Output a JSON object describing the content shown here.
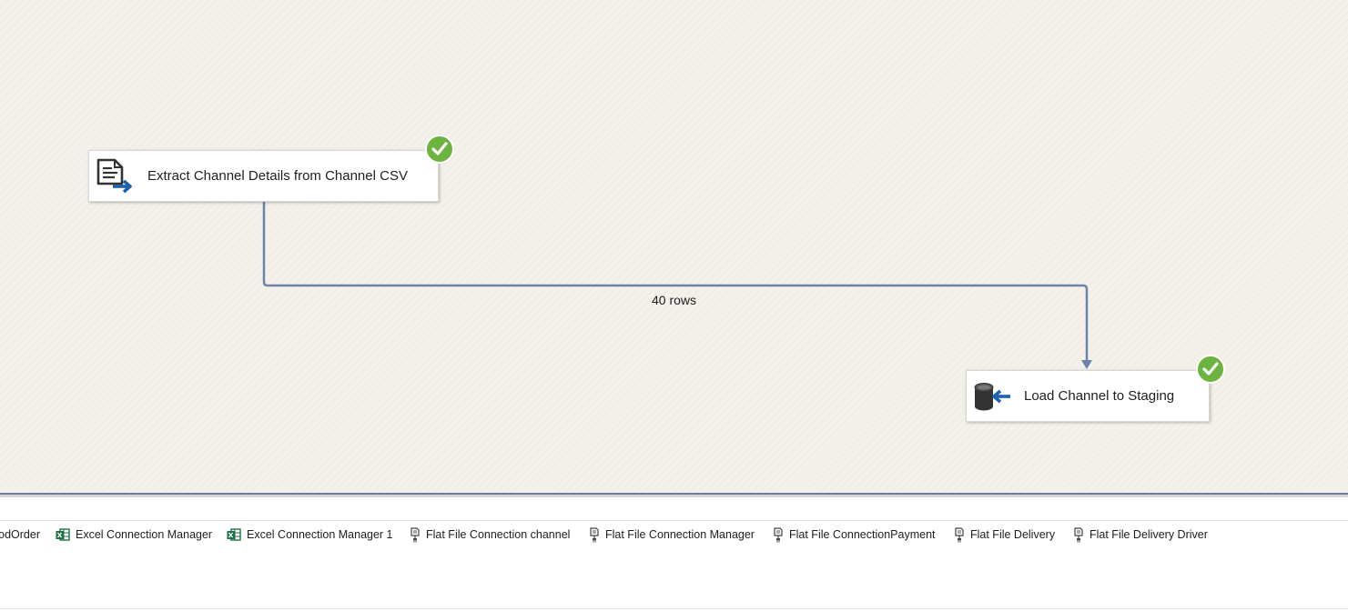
{
  "dataflow": {
    "tasks": [
      {
        "label": "Extract Channel Details from Channel CSV",
        "icon": "flat-file-source-icon",
        "status": "success"
      },
      {
        "label": "Load Channel to Staging",
        "icon": "ole-db-destination-icon",
        "status": "success"
      }
    ],
    "path": {
      "row_count_label": "40 rows"
    },
    "colors": {
      "path": "#6c82a8",
      "success": "#6cb33f",
      "canvas": "#f4f1ea"
    }
  },
  "connection_managers": [
    {
      "label": "odOrder",
      "icon": "none"
    },
    {
      "label": "Excel Connection Manager",
      "icon": "excel-connection-icon"
    },
    {
      "label": "Excel Connection Manager 1",
      "icon": "excel-connection-icon"
    },
    {
      "label": "Flat File Connection channel",
      "icon": "flat-file-connection-icon"
    },
    {
      "label": "Flat File Connection Manager",
      "icon": "flat-file-connection-icon"
    },
    {
      "label": "Flat File ConnectionPayment",
      "icon": "flat-file-connection-icon"
    },
    {
      "label": "Flat File Delivery",
      "icon": "flat-file-connection-icon"
    },
    {
      "label": "Flat File Delivery Driver",
      "icon": "flat-file-connection-icon"
    }
  ]
}
